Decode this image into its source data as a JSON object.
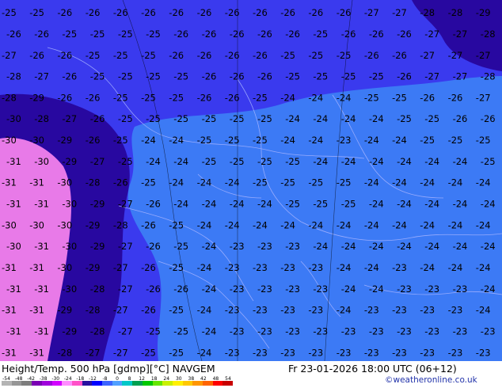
{
  "header": {
    "title": "Height/Temp. 500 hPa [gdmp][°C] NAVGEM",
    "valid": "Fr 23-01-2026 18:00 UTC (06+12)",
    "copyright": "©weatheronline.co.uk"
  },
  "colorbar": {
    "ticks": [
      "-54",
      "-48",
      "-42",
      "-38",
      "-30",
      "-24",
      "-18",
      "-12",
      "-8",
      "0",
      "8",
      "12",
      "18",
      "24",
      "30",
      "38",
      "42",
      "48",
      "54"
    ],
    "colors": [
      "#b4b4b4",
      "#969696",
      "#7d7d7d",
      "#7a00b4",
      "#a000dc",
      "#d200ff",
      "#ff8cff",
      "#ff50c8",
      "#2810a0",
      "#0000ff",
      "#3c64ff",
      "#50a0ff",
      "#00c8c8",
      "#00a050",
      "#00c800",
      "#64e600",
      "#c8f000",
      "#fff000",
      "#ffc800",
      "#ff9600",
      "#ff6400",
      "#ff0000",
      "#c80000"
    ]
  },
  "map": {
    "colors": {
      "lt_minus_32": "#e87ae8",
      "minus_32_to_28": "#2808a0",
      "minus_28_to_24": "#3a3aee",
      "minus_24_to_20": "#3c7af5",
      "boundaries": "#a8b4ff"
    },
    "labels": {
      "rows": [
        "-25 -25 -26 -26 -26 -26 -26 -26 -26 -26 -26 -26 -26 -27 -27 -28 -28 -29",
        "-26 -26 -25 -25 -25 -25 -26 -26 -26 -26 -26 -25 -26 -26 -26 -27 -27 -28",
        "-27 -26 -26 -25 -25 -25 -26 -26 -26 -26 -25 -25 -25 -26 -26 -27 -27 -27",
        "-28 -27 -26 -25 -25 -25 -25 -26 -26 -26 -25 -25 -25 -25 -26 -27 -27 -28",
        "-28 -29 -26 -26 -25 -25 -25 -26 -26 -25 -24 -24 -24 -25 -25 -26 -26 -27",
        "-30 -28 -27 -26 -25 -25 -25 -25 -25 -25 -24 -24 -24 -24 -25 -25 -26 -26",
        "-30 -30 -29 -26 -25 -24 -24 -25 -25 -25 -24 -24 -23 -24 -24 -25 -25 -25",
        "-31 -30 -29 -27 -25 -24 -24 -25 -25 -25 -25 -24 -24 -24 -24 -24 -24 -25",
        "-31 -31 -30 -28 -26 -25 -24 -24 -24 -25 -25 -25 -25 -24 -24 -24 -24 -24",
        "-31 -31 -30 -29 -27 -26 -24 -24 -24 -24 -25 -25 -25 -24 -24 -24 -24 -24",
        "-30 -30 -30 -29 -28 -26 -25 -24 -24 -24 -24 -24 -24 -24 -24 -24 -24 -24",
        "-30 -31 -30 -29 -27 -26 -25 -24 -23 -23 -23 -24 -24 -24 -24 -24 -24 -24",
        "-31 -31 -30 -29 -27 -26 -25 -24 -23 -23 -23 -23 -24 -24 -23 -24 -24 -24",
        "-31 -31 -30 -28 -27 -26 -26 -24 -23 -23 -23 -23 -24 -24 -23 -23 -23 -24",
        "-31 -31 -29 -28 -27 -26 -25 -24 -23 -23 -23 -23 -24 -23 -23 -23 -23 -24",
        "-31 -31 -29 -28 -27 -25 -25 -24 -23 -23 -23 -23 -23 -23 -23 -23 -23 -23",
        "-31 -31 -28 -27 -27 -25 -25 -24 -23 -23 -23 -23 -23 -23 -23 -23 -23 -23"
      ]
    }
  }
}
